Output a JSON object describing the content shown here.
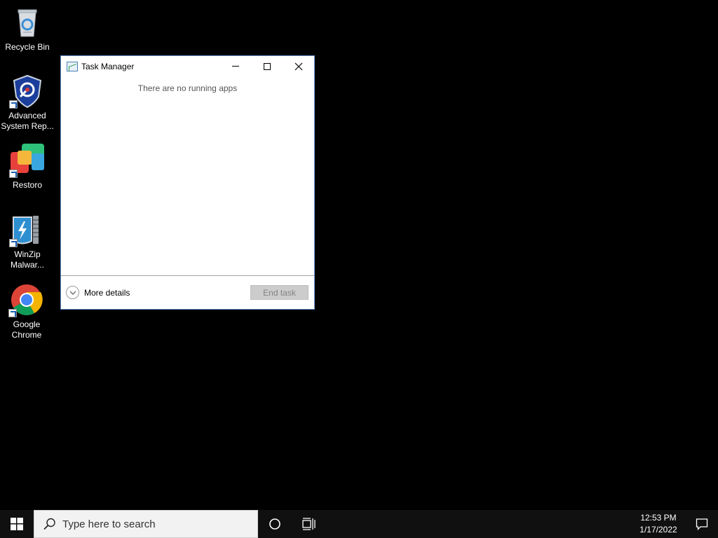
{
  "desktop": {
    "icons": [
      {
        "label": "Recycle Bin",
        "icon": "recycle-bin-icon"
      },
      {
        "label": "Advanced\nSystem Rep...",
        "icon": "advanced-system-repair-icon"
      },
      {
        "label": "Restoro",
        "icon": "restoro-icon"
      },
      {
        "label": "WinZip\nMalwar...",
        "icon": "winzip-malware-icon"
      },
      {
        "label": "Google\nChrome",
        "icon": "chrome-icon"
      }
    ]
  },
  "task_manager": {
    "title": "Task Manager",
    "empty_message": "There are no running apps",
    "more_details_label": "More details",
    "end_task_label": "End task"
  },
  "taskbar": {
    "search_placeholder": "Type here to search",
    "time": "12:53 PM",
    "date": "1/17/2022"
  }
}
